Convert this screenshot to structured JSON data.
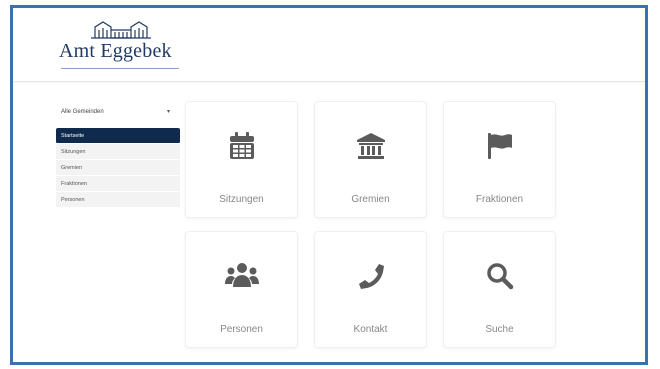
{
  "header": {
    "logo_text": "Amt Eggebek"
  },
  "sidebar": {
    "select": {
      "value": "Alle Gemeinden"
    },
    "items": [
      {
        "label": "Startseite",
        "active": true
      },
      {
        "label": "Sitzungen",
        "active": false
      },
      {
        "label": "Gremien",
        "active": false
      },
      {
        "label": "Fraktionen",
        "active": false
      },
      {
        "label": "Personen",
        "active": false
      }
    ]
  },
  "tiles": [
    {
      "label": "Sitzungen",
      "icon": "calendar-icon"
    },
    {
      "label": "Gremien",
      "icon": "building-columns-icon"
    },
    {
      "label": "Fraktionen",
      "icon": "flag-icon"
    },
    {
      "label": "Personen",
      "icon": "users-icon"
    },
    {
      "label": "Kontakt",
      "icon": "phone-icon"
    },
    {
      "label": "Suche",
      "icon": "search-icon"
    }
  ],
  "colors": {
    "frame": "#3f6fae",
    "nav_active": "#102a4e",
    "icon": "#5b5b5b",
    "logo": "#1f3b63"
  }
}
